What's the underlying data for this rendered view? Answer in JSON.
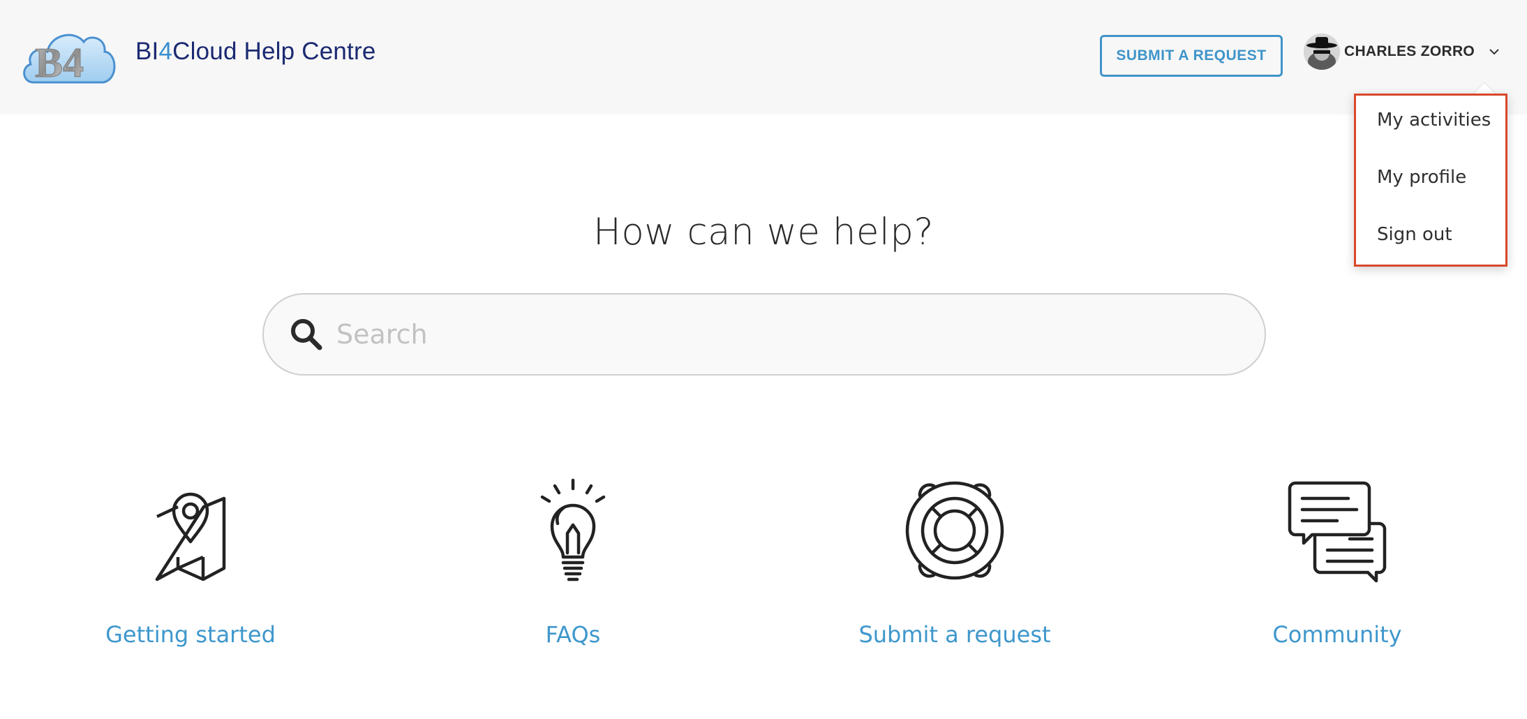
{
  "header": {
    "brand": {
      "prefix": "BI",
      "accent": "4",
      "suffix": "Cloud Help Centre",
      "logo_text": "BI4"
    },
    "submit_request_label": "SUBMIT A REQUEST",
    "user": {
      "name": "CHARLES ZORRO",
      "avatar_icon": "avatar-zorro"
    }
  },
  "user_dropdown": {
    "items": [
      {
        "label": "My activities"
      },
      {
        "label": "My profile"
      },
      {
        "label": "Sign out"
      }
    ]
  },
  "hero": {
    "title": "How can we help?",
    "search": {
      "placeholder": "Search",
      "value": "",
      "icon": "search-icon"
    }
  },
  "categories": [
    {
      "label": "Getting started",
      "icon": "map-pin-icon"
    },
    {
      "label": "FAQs",
      "icon": "lightbulb-icon"
    },
    {
      "label": "Submit a request",
      "icon": "lifebuoy-icon"
    },
    {
      "label": "Community",
      "icon": "chat-bubbles-icon"
    }
  ],
  "colors": {
    "brand_navy": "#1b2a72",
    "accent_blue": "#3f94c9",
    "link_blue": "#3e97cc",
    "dropdown_highlight": "#d9472b",
    "header_bg": "#f7f7f7"
  }
}
